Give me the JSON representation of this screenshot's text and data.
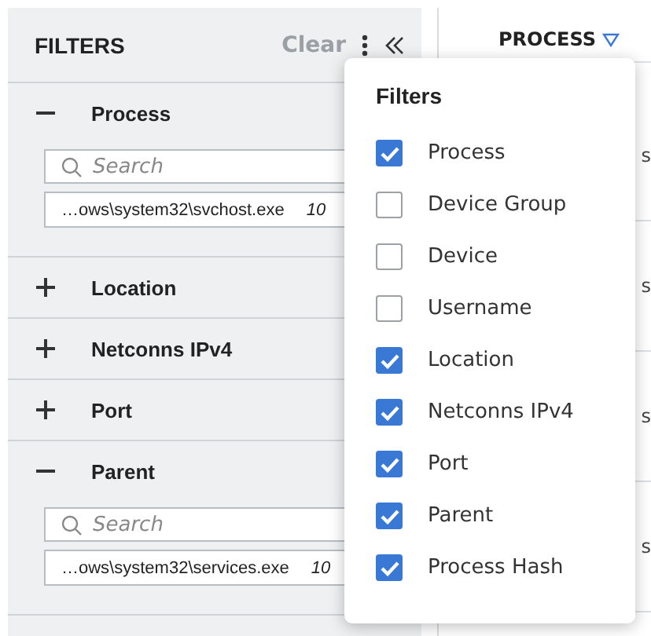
{
  "filters_panel": {
    "title": "FILTERS",
    "clear": "Clear",
    "sections": [
      {
        "label": "Process",
        "expanded": true,
        "placeholder": "Search",
        "result": {
          "value": "…ows\\system32\\svchost.exe",
          "count": "10"
        }
      },
      {
        "label": "Location",
        "expanded": false
      },
      {
        "label": "Netconns IPv4",
        "expanded": false
      },
      {
        "label": "Port",
        "expanded": false
      },
      {
        "label": "Parent",
        "expanded": true,
        "placeholder": "Search",
        "result": {
          "value": "…ows\\system32\\services.exe",
          "count": "10"
        }
      }
    ]
  },
  "table": {
    "header": "PROCESS",
    "rows": [
      "s",
      "s",
      "s",
      "s"
    ]
  },
  "filters_menu": {
    "title": "Filters",
    "items": [
      {
        "label": "Process",
        "checked": true
      },
      {
        "label": "Device Group",
        "checked": false
      },
      {
        "label": "Device",
        "checked": false
      },
      {
        "label": "Username",
        "checked": false
      },
      {
        "label": "Location",
        "checked": true
      },
      {
        "label": "Netconns IPv4",
        "checked": true
      },
      {
        "label": "Port",
        "checked": true
      },
      {
        "label": "Parent",
        "checked": true
      },
      {
        "label": "Process Hash",
        "checked": true
      }
    ]
  }
}
